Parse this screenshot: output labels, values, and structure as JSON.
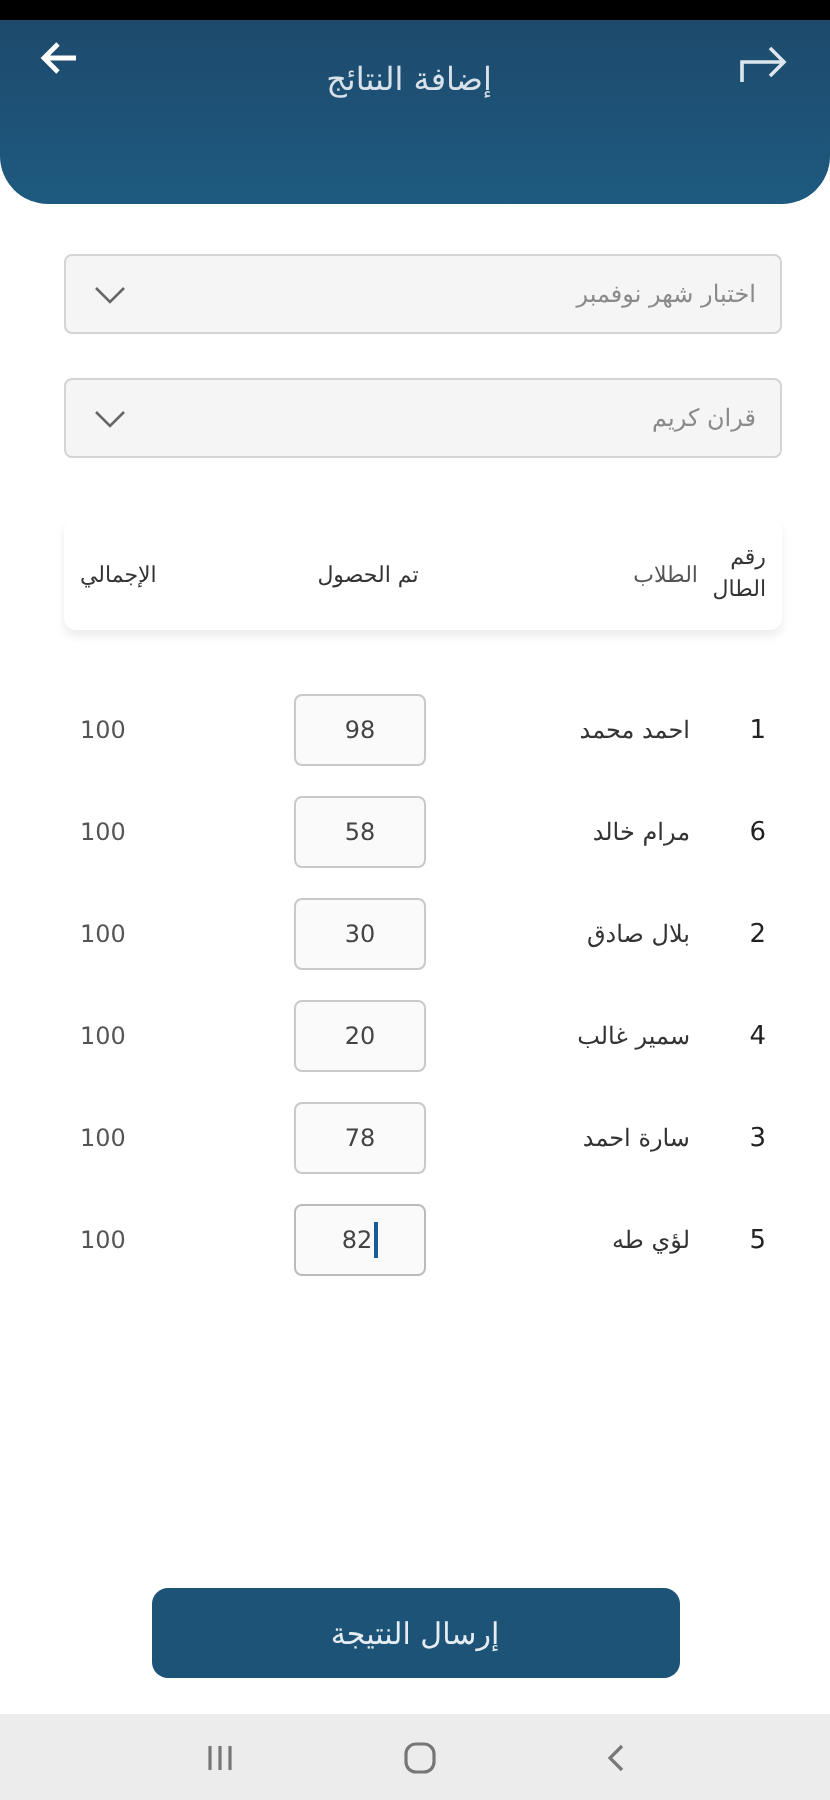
{
  "header": {
    "title": "إضافة النتائج"
  },
  "dropdowns": [
    {
      "placeholder": "اختبار شهر نوفمبر"
    },
    {
      "placeholder": "قران كريم"
    }
  ],
  "table": {
    "columns": [
      "رقم الطال",
      "الطلاب",
      "تم الحصول",
      "الإجمالي"
    ],
    "rows": [
      {
        "number": "1",
        "name": "احمد محمد",
        "score": "98",
        "total": "100",
        "focused": false
      },
      {
        "number": "6",
        "name": "مرام خالد",
        "score": "58",
        "total": "100",
        "focused": false
      },
      {
        "number": "2",
        "name": "بلال صادق",
        "score": "30",
        "total": "100",
        "focused": false
      },
      {
        "number": "4",
        "name": "سمير غالب",
        "score": "20",
        "total": "100",
        "focused": false
      },
      {
        "number": "3",
        "name": "سارة احمد",
        "score": "78",
        "total": "100",
        "focused": false
      },
      {
        "number": "5",
        "name": "لؤي طه",
        "score": "82",
        "total": "100",
        "focused": true
      }
    ]
  },
  "submit_button": "إرسال النتيجة"
}
